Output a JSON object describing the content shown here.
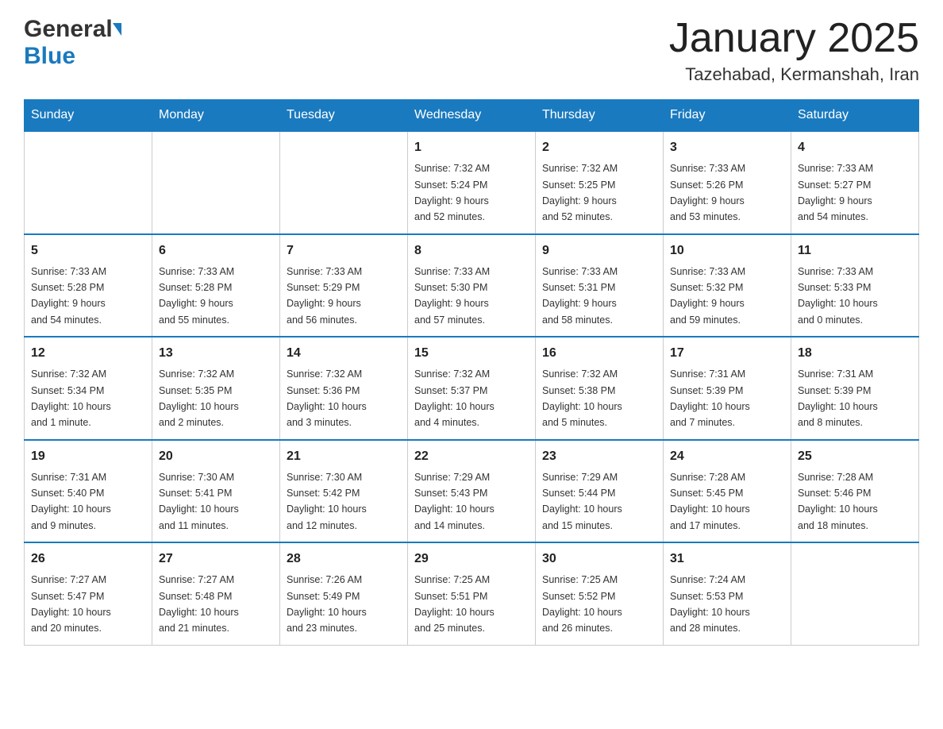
{
  "header": {
    "logo_general": "General",
    "logo_blue": "Blue",
    "month_title": "January 2025",
    "location": "Tazehabad, Kermanshah, Iran"
  },
  "days_of_week": [
    "Sunday",
    "Monday",
    "Tuesday",
    "Wednesday",
    "Thursday",
    "Friday",
    "Saturday"
  ],
  "weeks": [
    [
      {
        "day": "",
        "info": ""
      },
      {
        "day": "",
        "info": ""
      },
      {
        "day": "",
        "info": ""
      },
      {
        "day": "1",
        "info": "Sunrise: 7:32 AM\nSunset: 5:24 PM\nDaylight: 9 hours\nand 52 minutes."
      },
      {
        "day": "2",
        "info": "Sunrise: 7:32 AM\nSunset: 5:25 PM\nDaylight: 9 hours\nand 52 minutes."
      },
      {
        "day": "3",
        "info": "Sunrise: 7:33 AM\nSunset: 5:26 PM\nDaylight: 9 hours\nand 53 minutes."
      },
      {
        "day": "4",
        "info": "Sunrise: 7:33 AM\nSunset: 5:27 PM\nDaylight: 9 hours\nand 54 minutes."
      }
    ],
    [
      {
        "day": "5",
        "info": "Sunrise: 7:33 AM\nSunset: 5:28 PM\nDaylight: 9 hours\nand 54 minutes."
      },
      {
        "day": "6",
        "info": "Sunrise: 7:33 AM\nSunset: 5:28 PM\nDaylight: 9 hours\nand 55 minutes."
      },
      {
        "day": "7",
        "info": "Sunrise: 7:33 AM\nSunset: 5:29 PM\nDaylight: 9 hours\nand 56 minutes."
      },
      {
        "day": "8",
        "info": "Sunrise: 7:33 AM\nSunset: 5:30 PM\nDaylight: 9 hours\nand 57 minutes."
      },
      {
        "day": "9",
        "info": "Sunrise: 7:33 AM\nSunset: 5:31 PM\nDaylight: 9 hours\nand 58 minutes."
      },
      {
        "day": "10",
        "info": "Sunrise: 7:33 AM\nSunset: 5:32 PM\nDaylight: 9 hours\nand 59 minutes."
      },
      {
        "day": "11",
        "info": "Sunrise: 7:33 AM\nSunset: 5:33 PM\nDaylight: 10 hours\nand 0 minutes."
      }
    ],
    [
      {
        "day": "12",
        "info": "Sunrise: 7:32 AM\nSunset: 5:34 PM\nDaylight: 10 hours\nand 1 minute."
      },
      {
        "day": "13",
        "info": "Sunrise: 7:32 AM\nSunset: 5:35 PM\nDaylight: 10 hours\nand 2 minutes."
      },
      {
        "day": "14",
        "info": "Sunrise: 7:32 AM\nSunset: 5:36 PM\nDaylight: 10 hours\nand 3 minutes."
      },
      {
        "day": "15",
        "info": "Sunrise: 7:32 AM\nSunset: 5:37 PM\nDaylight: 10 hours\nand 4 minutes."
      },
      {
        "day": "16",
        "info": "Sunrise: 7:32 AM\nSunset: 5:38 PM\nDaylight: 10 hours\nand 5 minutes."
      },
      {
        "day": "17",
        "info": "Sunrise: 7:31 AM\nSunset: 5:39 PM\nDaylight: 10 hours\nand 7 minutes."
      },
      {
        "day": "18",
        "info": "Sunrise: 7:31 AM\nSunset: 5:39 PM\nDaylight: 10 hours\nand 8 minutes."
      }
    ],
    [
      {
        "day": "19",
        "info": "Sunrise: 7:31 AM\nSunset: 5:40 PM\nDaylight: 10 hours\nand 9 minutes."
      },
      {
        "day": "20",
        "info": "Sunrise: 7:30 AM\nSunset: 5:41 PM\nDaylight: 10 hours\nand 11 minutes."
      },
      {
        "day": "21",
        "info": "Sunrise: 7:30 AM\nSunset: 5:42 PM\nDaylight: 10 hours\nand 12 minutes."
      },
      {
        "day": "22",
        "info": "Sunrise: 7:29 AM\nSunset: 5:43 PM\nDaylight: 10 hours\nand 14 minutes."
      },
      {
        "day": "23",
        "info": "Sunrise: 7:29 AM\nSunset: 5:44 PM\nDaylight: 10 hours\nand 15 minutes."
      },
      {
        "day": "24",
        "info": "Sunrise: 7:28 AM\nSunset: 5:45 PM\nDaylight: 10 hours\nand 17 minutes."
      },
      {
        "day": "25",
        "info": "Sunrise: 7:28 AM\nSunset: 5:46 PM\nDaylight: 10 hours\nand 18 minutes."
      }
    ],
    [
      {
        "day": "26",
        "info": "Sunrise: 7:27 AM\nSunset: 5:47 PM\nDaylight: 10 hours\nand 20 minutes."
      },
      {
        "day": "27",
        "info": "Sunrise: 7:27 AM\nSunset: 5:48 PM\nDaylight: 10 hours\nand 21 minutes."
      },
      {
        "day": "28",
        "info": "Sunrise: 7:26 AM\nSunset: 5:49 PM\nDaylight: 10 hours\nand 23 minutes."
      },
      {
        "day": "29",
        "info": "Sunrise: 7:25 AM\nSunset: 5:51 PM\nDaylight: 10 hours\nand 25 minutes."
      },
      {
        "day": "30",
        "info": "Sunrise: 7:25 AM\nSunset: 5:52 PM\nDaylight: 10 hours\nand 26 minutes."
      },
      {
        "day": "31",
        "info": "Sunrise: 7:24 AM\nSunset: 5:53 PM\nDaylight: 10 hours\nand 28 minutes."
      },
      {
        "day": "",
        "info": ""
      }
    ]
  ]
}
